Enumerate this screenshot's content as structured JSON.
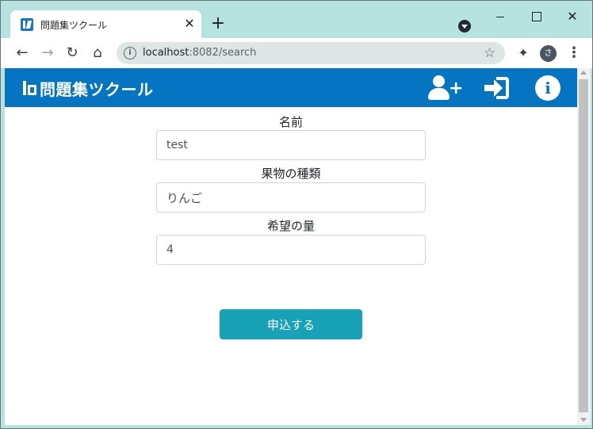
{
  "browser": {
    "tab_title": "問題集ツクール",
    "tab_close": "✕",
    "new_tab": "+",
    "url_host": "localhost",
    "url_path": ":8082/search",
    "avatar_letter": "さ"
  },
  "app": {
    "brand": "問題集ツクール"
  },
  "form": {
    "name_label": "名前",
    "name_value": "test",
    "fruit_label": "果物の種類",
    "fruit_value": "りんご",
    "qty_label": "希望の量",
    "qty_value": "4",
    "submit_label": "申込する"
  },
  "colors": {
    "header_bg": "#0575c2",
    "submit_bg": "#17a2b8",
    "tabstrip_bg": "#b6e2e0"
  },
  "icons": {
    "favicon": "app-logo-icon",
    "header": [
      "add-user-icon",
      "sign-in-icon",
      "info-icon"
    ]
  }
}
